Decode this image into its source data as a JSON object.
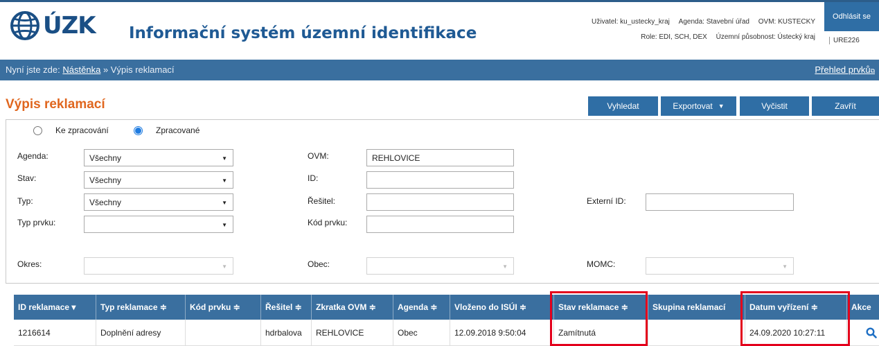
{
  "header": {
    "logo_text": "ÚZK",
    "app_title": "Informační systém územní identifikace",
    "user_row1": [
      "Uživatel: ku_ustecky_kraj",
      "Agenda: Stavební úřad",
      "OVM: KUSTECKY"
    ],
    "user_row2": [
      "Role: EDI, SCH, DEX",
      "Územní působnost: Ústecký kraj"
    ],
    "ure": "URE226",
    "logout_label": "Odhlásit se"
  },
  "breadcrumb": {
    "prefix": "Nyní jste zde:",
    "home": "Nástěnka",
    "sep": "»",
    "current": "Výpis reklamací",
    "overview": "Přehled prvků"
  },
  "page": {
    "title": "Výpis reklamací",
    "buttons": {
      "search": "Vyhledat",
      "export": "Exportovat",
      "clear": "Vyčistit",
      "close": "Zavřít"
    }
  },
  "filters": {
    "radio_pending": "Ke zpracování",
    "radio_processed": "Zpracované",
    "agenda_label": "Agenda:",
    "agenda_value": "Všechny",
    "stav_label": "Stav:",
    "stav_value": "Všechny",
    "typ_label": "Typ:",
    "typ_value": "Všechny",
    "typ_prvku_label": "Typ prvku:",
    "typ_prvku_value": "",
    "ovm_label": "OVM:",
    "ovm_value": "REHLOVICE",
    "id_label": "ID:",
    "id_value": "",
    "resitel_label": "Řešitel:",
    "resitel_value": "",
    "kod_prvku_label": "Kód prvku:",
    "kod_prvku_value": "",
    "externi_id_label": "Externí ID:",
    "externi_id_value": "",
    "okres_label": "Okres:",
    "obec_label": "Obec:",
    "momc_label": "MOMC:"
  },
  "table": {
    "headers": [
      "ID reklamace",
      "Typ reklamace ≑",
      "Kód prvku ≑",
      "Řešitel ≑",
      "Zkratka OVM ≑",
      "Agenda ≑",
      "Vloženo do ISÚI ≑",
      "Stav reklamace ≑",
      "Skupina reklamací",
      "Datum vyřízení ≑",
      "Akce"
    ],
    "sort_desc_glyph": "▾",
    "rows": [
      [
        "1216614",
        "Doplnění adresy",
        "",
        "hdrbalova",
        "REHLOVICE",
        "Obec",
        "12.09.2018 9:50:04",
        "Zamítnutá",
        "",
        "24.09.2020 10:27:11"
      ]
    ]
  },
  "colors": {
    "brand_blue": "#3a6f9f",
    "title_orange": "#e0661e",
    "highlight_red": "#e3001b"
  }
}
